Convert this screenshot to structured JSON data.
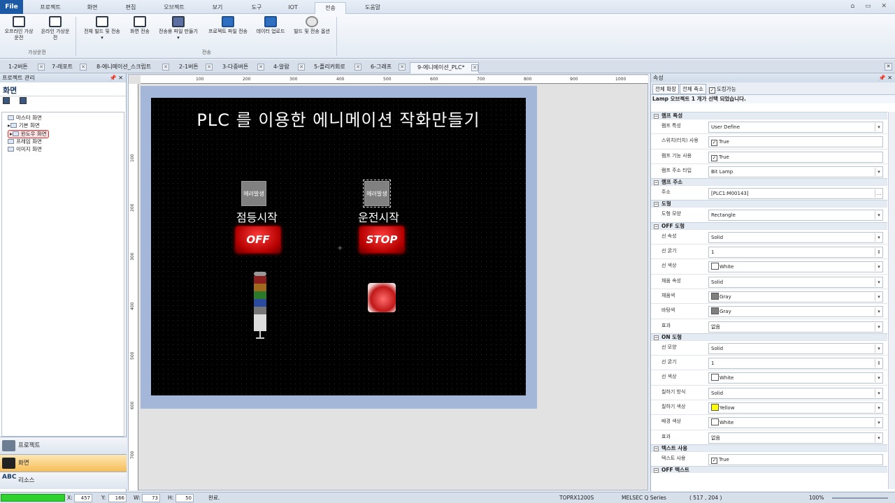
{
  "menu": {
    "file": "File",
    "tabs": [
      "프로젝트",
      "화면",
      "편집",
      "오브젝트",
      "보기",
      "도구",
      "IOT",
      "전송",
      "도움말"
    ],
    "active_tab": "전송"
  },
  "ribbon": {
    "offline_sim": "오프라인 가상\n운전",
    "online_sim": "온라인 가상운\n전",
    "group_sim": "가상운전",
    "build_transfer_all": "전체 빌드 및 전송",
    "screen_transfer": "화면 전송",
    "make_transfer_file": "전송용 파일 만들기",
    "project_file_transfer": "프로젝트 파일 전송",
    "data_upload": "데이터 업로드",
    "build_transfer_options": "빌드 및 전송 옵션",
    "group_transfer": "전송"
  },
  "doc_tabs": [
    "1-2버튼",
    "7-레포트",
    "8-에니메이션_스크립트",
    "2-1버튼",
    "3-다중버튼",
    "4-알람",
    "5-플리커회로",
    "6-그래프",
    "9-에니메이션_PLC*"
  ],
  "active_doc_tab": "9-에니메이션_PLC*",
  "left_panel": {
    "header": "프로젝트 관리",
    "title": "화면",
    "tree": [
      "마스터 화면",
      "기본 화면",
      "윈도우 화면",
      "프레임 화면",
      "이미지 화면"
    ],
    "selected": "윈도우 화면",
    "nav": [
      "프로젝트",
      "화면",
      "리소스"
    ],
    "nav_active": "화면",
    "resource_icon_text": "ABC"
  },
  "ruler": {
    "h": [
      "100",
      "200",
      "300",
      "400",
      "500",
      "600",
      "700",
      "800",
      "900",
      "1000"
    ],
    "v": [
      "100",
      "200",
      "300",
      "400",
      "500",
      "600",
      "700"
    ]
  },
  "screen": {
    "title": "PLC 를 이용한 에니메이션 작화만들기",
    "lamp1_text": "에러발생",
    "lamp2_text": "에러발생",
    "label1": "점등시작",
    "label2": "운전시작",
    "btn_off": "OFF",
    "btn_stop": "STOP"
  },
  "properties": {
    "header": "속성",
    "tab_expand": "전체 확장",
    "tab_collapse": "전체 축소",
    "docking": "도킹가능",
    "info": "Lamp 오브젝트 1 개가 선택 되었습니다.",
    "sections": [
      {
        "name": "램프 특성",
        "rows": [
          {
            "name": "램프 특성",
            "value": "User Define",
            "ctl": "dd"
          },
          {
            "name": "스위치(터치) 사용",
            "value": "True",
            "ctl": "chk"
          },
          {
            "name": "램프 기능 사용",
            "value": "True",
            "ctl": "chk"
          },
          {
            "name": "램프 주소 타입",
            "value": "Bit Lamp",
            "ctl": "dd"
          }
        ]
      },
      {
        "name": "램프 주소",
        "rows": [
          {
            "name": "주소",
            "value": "[PLC1:M00143]",
            "ctl": "more"
          }
        ]
      },
      {
        "name": "도형",
        "rows": [
          {
            "name": "도형 모양",
            "value": "Rectangle",
            "ctl": "dd"
          }
        ]
      },
      {
        "name": "OFF 도형",
        "rows": [
          {
            "name": "선 속성",
            "value": "Solid",
            "ctl": "dd"
          },
          {
            "name": "선 굵기",
            "value": "1",
            "ctl": "spin"
          },
          {
            "name": "선 색상",
            "value": "White",
            "ctl": "dd",
            "swatch": "#ffffff"
          },
          {
            "name": "채움 속성",
            "value": "Solid",
            "ctl": "dd"
          },
          {
            "name": "채움색",
            "value": "Gray",
            "ctl": "dd",
            "swatch": "#808080"
          },
          {
            "name": "바탕색",
            "value": "Gray",
            "ctl": "dd",
            "swatch": "#808080"
          },
          {
            "name": "효과",
            "value": "없음",
            "ctl": "dd"
          }
        ]
      },
      {
        "name": "ON 도형",
        "rows": [
          {
            "name": "선 모양",
            "value": "Solid",
            "ctl": "dd"
          },
          {
            "name": "선 굵기",
            "value": "1",
            "ctl": "spin"
          },
          {
            "name": "선 색상",
            "value": "White",
            "ctl": "dd",
            "swatch": "#ffffff"
          },
          {
            "name": "칠하기 방식",
            "value": "Solid",
            "ctl": "dd"
          },
          {
            "name": "칠하기 색상",
            "value": "Yellow",
            "ctl": "dd",
            "swatch": "#ffff00"
          },
          {
            "name": "배경 색상",
            "value": "White",
            "ctl": "dd",
            "swatch": "#ffffff"
          },
          {
            "name": "효과",
            "value": "없음",
            "ctl": "dd"
          }
        ]
      },
      {
        "name": "텍스트 사용",
        "rows": [
          {
            "name": "텍스트 사용",
            "value": "True",
            "ctl": "chk"
          }
        ]
      },
      {
        "name": "OFF 텍스트",
        "rows": []
      }
    ]
  },
  "status": {
    "x_label": "X:",
    "x": "457",
    "y_label": "Y:",
    "y": "166",
    "w_label": "W:",
    "w": "73",
    "h_label": "H:",
    "h": "50",
    "message": "완료.",
    "device": "TOPRX1200S",
    "plc": "MELSEC Q Series",
    "coord": "( 517 , 204 )",
    "zoom": "100%"
  },
  "colors": {
    "screen_bg": "#000000",
    "frame_bg": "#a5b7d9",
    "lamp_gray": "#808080",
    "button_red": "#d00000",
    "accent": "#1d5aa6"
  }
}
